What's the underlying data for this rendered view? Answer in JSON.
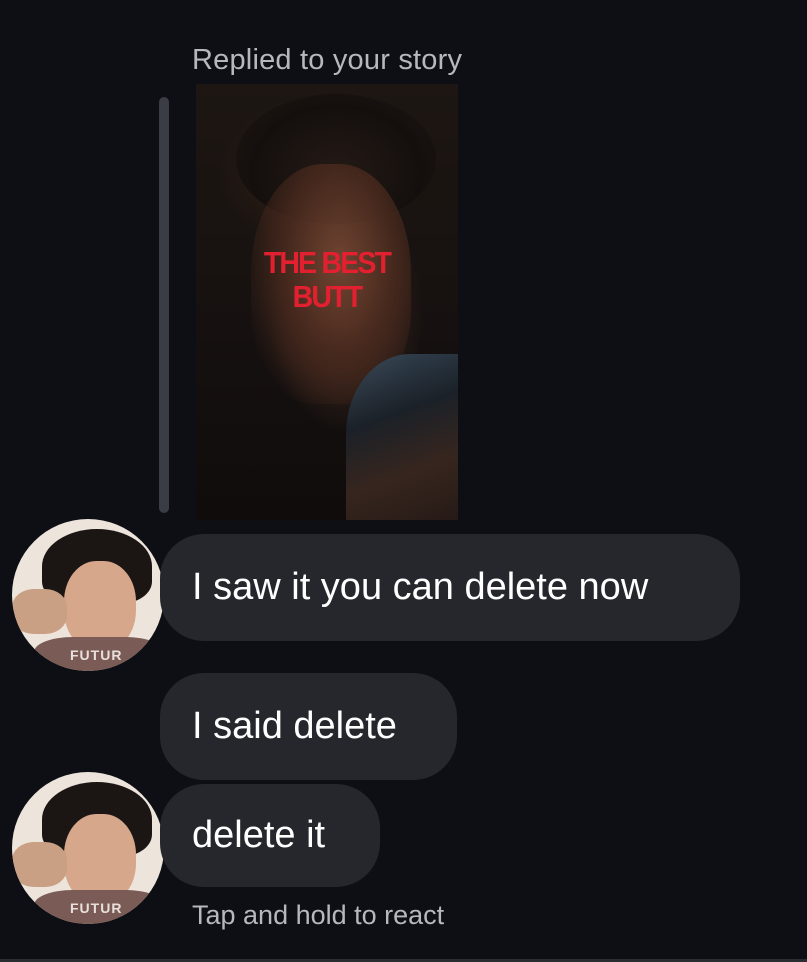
{
  "story_reply": {
    "header": "Replied to your story",
    "story_text_line1": "THE BEST",
    "story_text_line2": "BUTT"
  },
  "avatar_text": "FUTUR",
  "messages": [
    {
      "text": "I saw it you can delete now"
    },
    {
      "text": "I said delete"
    },
    {
      "text": "delete it"
    }
  ],
  "footer_hint": "Tap and hold to react",
  "colors": {
    "background": "#0d0f14",
    "bubble": "#26272d",
    "story_text": "#e3202f",
    "muted_text": "#b7b8bd"
  }
}
